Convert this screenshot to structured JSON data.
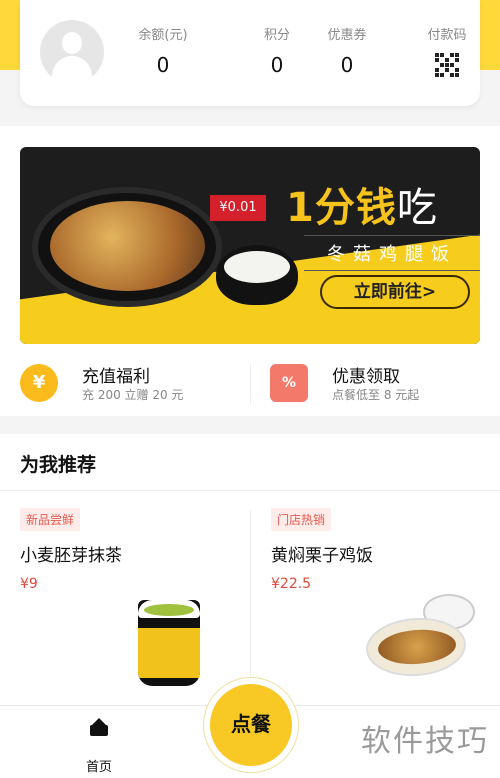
{
  "account": {
    "balance": {
      "label": "余额(元)",
      "value": "0"
    },
    "points": {
      "label": "积分",
      "value": "0"
    },
    "coupons": {
      "label": "优惠券",
      "value": "0"
    },
    "pay_code": {
      "label": "付款码",
      "icon": "qr-code-icon"
    }
  },
  "banner": {
    "price_tag": "¥0.01",
    "headline_main": "1分钱",
    "headline_eat": "吃",
    "subtitle": "冬菇鸡腿饭",
    "cta": "立即前往>"
  },
  "promos": [
    {
      "icon": "coin-yen-icon",
      "icon_text": "¥",
      "title": "充值福利",
      "subtitle": "充 200 立赠 20 元"
    },
    {
      "icon": "coupon-ticket-icon",
      "icon_text": "%",
      "title": "优惠领取",
      "subtitle": "点餐低至 8 元起"
    }
  ],
  "recommend": {
    "title": "为我推荐",
    "products": [
      {
        "tag": "新品尝鲜",
        "name": "小麦胚芽抹茶",
        "price": "¥9"
      },
      {
        "tag": "门店热销",
        "name": "黄焖栗子鸡饭",
        "price": "¥22.5"
      }
    ]
  },
  "tabbar": {
    "home_label": "首页",
    "order_label": "点餐"
  },
  "watermark": "软件技巧",
  "colors": {
    "accent": "#f8c925",
    "price": "#e04a3a",
    "tag_bg": "#fdecea"
  }
}
